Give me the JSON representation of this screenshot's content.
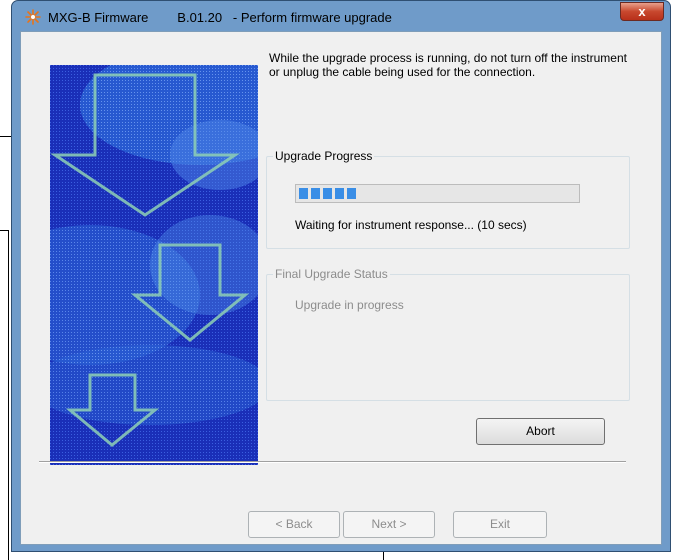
{
  "window": {
    "title": "MXG-B Firmware        B.01.20   - Perform firmware upgrade",
    "close_label": "x",
    "icon": "agilent-spark-icon"
  },
  "message": "While the upgrade process is running, do not turn off the instrument or unplug the cable being used for the connection.",
  "upgrade_progress": {
    "title": "Upgrade Progress",
    "progress_segments_filled": 5,
    "status_text": "Waiting for instrument response... (10 secs)"
  },
  "final_status": {
    "title": "Final Upgrade Status",
    "text": "Upgrade in progress"
  },
  "buttons": {
    "abort": "Abort",
    "back": "< Back",
    "next": "Next >",
    "exit": "Exit"
  },
  "colors": {
    "title_bar": "#6f9bc9",
    "client_bg": "#f0f0f0",
    "banner_blue": "#1a2fb8",
    "progress_fill": "#3a8ee6",
    "close_red": "#c8482e"
  }
}
